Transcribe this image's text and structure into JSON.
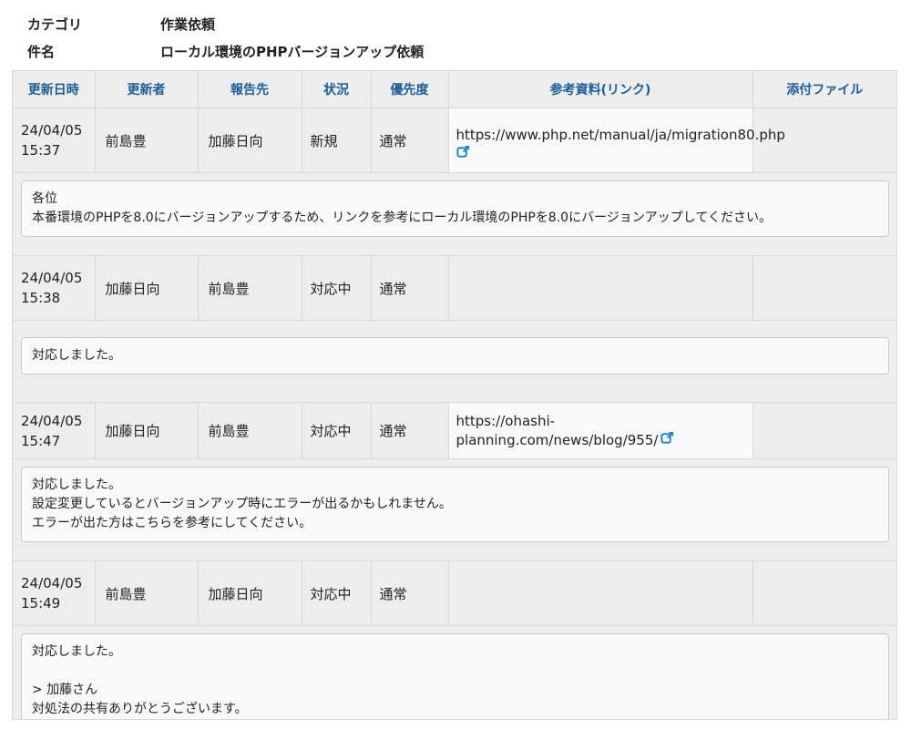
{
  "meta": {
    "category_label": "カテゴリ",
    "category_value": "作業依頼",
    "subject_label": "件名",
    "subject_value": "ローカル環境のPHPバージョンアップ依頼"
  },
  "columns": [
    "更新日時",
    "更新者",
    "報告先",
    "状況",
    "優先度",
    "参考資料(リンク)",
    "添付ファイル"
  ],
  "entries": [
    {
      "date": "24/04/05",
      "time": "15:37",
      "updater": "前島豊",
      "reporter": "加藤日向",
      "status": "新規",
      "priority": "通常",
      "link": "https://www.php.net/manual/ja/migration80.php",
      "attachment": "",
      "message": [
        "各位",
        "本番環境のPHPを8.0にバージョンアップするため、リンクを参考にローカル環境のPHPを8.0にバージョンアップしてください。"
      ]
    },
    {
      "date": "24/04/05",
      "time": "15:38",
      "updater": "加藤日向",
      "reporter": "前島豊",
      "status": "対応中",
      "priority": "通常",
      "link": "",
      "attachment": "",
      "message": [
        "対応しました。"
      ]
    },
    {
      "date": "24/04/05",
      "time": "15:47",
      "updater": "加藤日向",
      "reporter": "前島豊",
      "status": "対応中",
      "priority": "通常",
      "link": "https://ohashi-planning.com/news/blog/955/",
      "attachment": "",
      "message": [
        "対応しました。",
        "設定変更しているとバージョンアップ時にエラーが出るかもしれません。",
        "エラーが出た方はこちらを参考にしてください。"
      ]
    },
    {
      "date": "24/04/05",
      "time": "15:49",
      "updater": "前島豊",
      "reporter": "加藤日向",
      "status": "対応中",
      "priority": "通常",
      "link": "",
      "attachment": "",
      "message": [
        "対応しました。",
        "",
        "> 加藤さん",
        "対処法の共有ありがとうございます。"
      ]
    }
  ],
  "colors": {
    "header_text": "#1a5f99",
    "link_icon": "#1a7fd4",
    "row_bg": "#ededed",
    "cell_highlight": "#f9f9f9"
  },
  "icons": {
    "external_link": "external-link-icon"
  }
}
